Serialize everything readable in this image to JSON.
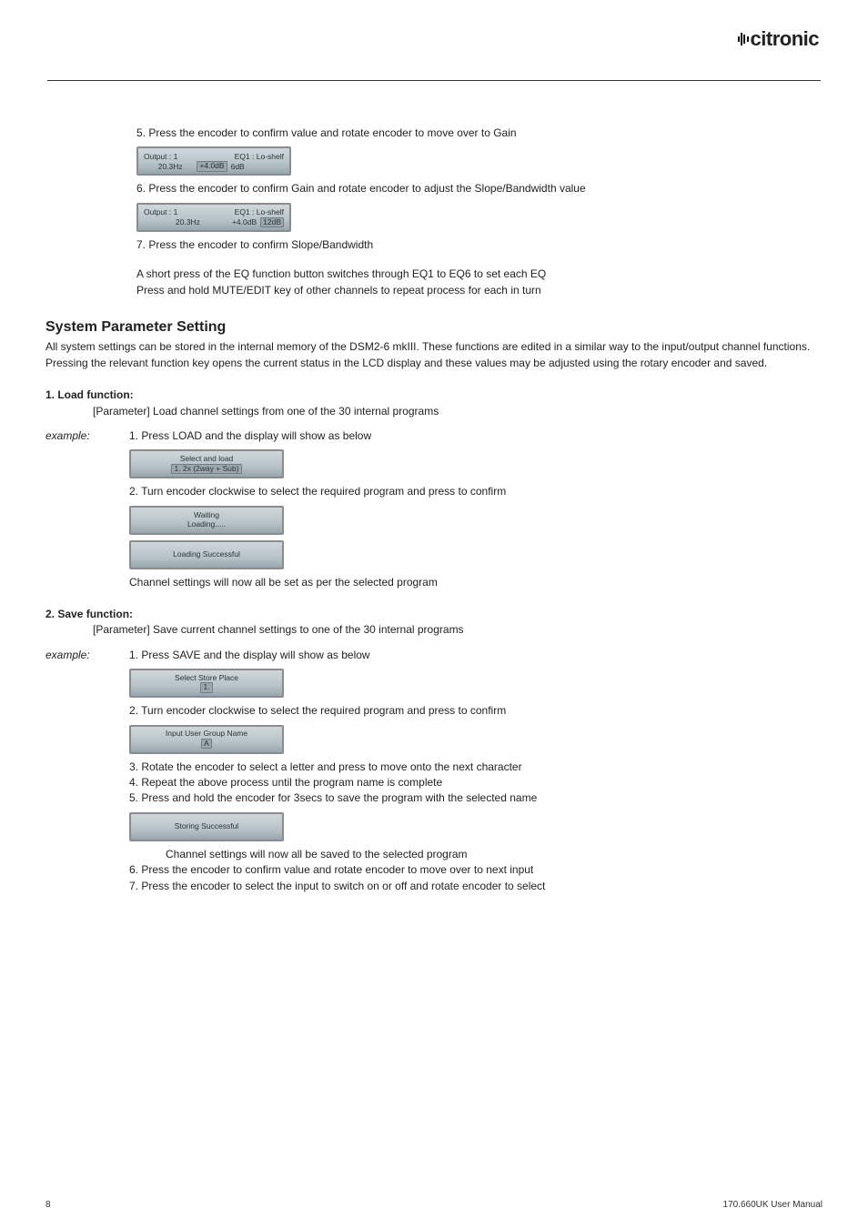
{
  "brand": "citronic",
  "steps_top": {
    "s5": "5. Press the encoder to confirm value and rotate encoder to move over to Gain",
    "lcd1": {
      "row1_left": "Output : 1",
      "row1_right": "EQ1 : Lo-shelf",
      "row2_left": "20.3Hz",
      "row2_mid": "+4.0dB",
      "row2_right": "6dB"
    },
    "s6": "6. Press the encoder to confirm Gain and rotate encoder to adjust the Slope/Bandwidth value",
    "lcd2": {
      "row1_left": "Output : 1",
      "row1_right": "EQ1 : Lo-shelf",
      "row2_left": "20.3Hz",
      "row2_mid": "+4.0dB",
      "row2_right": "12dB"
    },
    "s7": "7. Press the encoder to confirm Slope/Bandwidth",
    "note1": "A short press of the EQ function button switches through EQ1 to EQ6 to set each EQ",
    "note2": "Press and hold MUTE/EDIT key of other channels to repeat process for each in turn"
  },
  "sys_heading": "System Parameter Setting",
  "sys_para": "All system settings can be stored in the internal memory of the DSM2-6 mkIII. These functions are edited in a similar way to the input/output channel functions. Pressing the relevant function key opens the current status in the LCD display and these values may be adjusted using the rotary encoder and saved.",
  "load": {
    "h": "1. Load function:",
    "param": "[Parameter] Load channel settings from one of the 30 internal programs",
    "example_label": "example:",
    "s1": "1. Press LOAD and the display will show as below",
    "lcd1_l1": "Select and load",
    "lcd1_l2": "1. 2x (2way + Sub)",
    "s2": "2. Turn encoder clockwise to select the required program and press to confirm",
    "lcd2_l1": "Waiting",
    "lcd2_l2": "Loading.....",
    "lcd3_l1": "Loading Successful",
    "end": "Channel settings will now all be set as per the selected program"
  },
  "save": {
    "h": "2. Save function:",
    "param": "[Parameter] Save current channel settings to one of the 30 internal programs",
    "example_label": "example:",
    "s1": "1. Press SAVE and the display will show as below",
    "lcd1_l1": "Select Store Place",
    "lcd1_l2": "1.",
    "s2": "2. Turn encoder clockwise to select the required program and press to confirm",
    "lcd2_l1": "Input User Group Name",
    "lcd2_l2": "A",
    "s3": "3. Rotate the encoder to select a letter and press to move onto the next character",
    "s4": "4. Repeat the above process until the program name is complete",
    "s5": "5. Press and hold the encoder for 3secs to save the program with the selected name",
    "lcd3_l1": "Storing Successful",
    "end": "Channel settings will now all be saved to the selected program",
    "s6": "6. Press the encoder to confirm value and rotate encoder to move over to next input",
    "s7": "7. Press the encoder to select the input to switch on or off and rotate encoder to select"
  },
  "footer": {
    "page": "8",
    "manual": "170.660UK User Manual"
  }
}
